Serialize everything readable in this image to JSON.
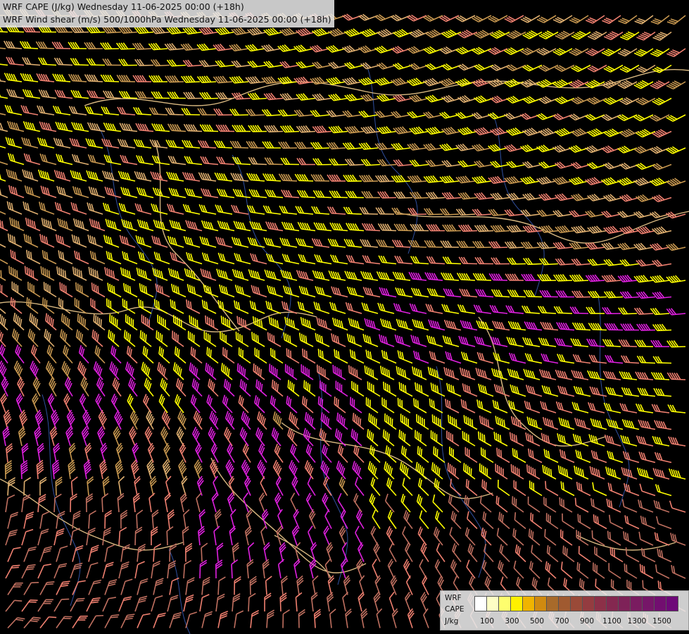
{
  "title": {
    "line1": "WRF CAPE (J/kg) Wednesday 11-06-2025 00:00 (+18h)",
    "line2": "WRF Wind shear (m/s) 500/1000hPa Wednesday 11-06-2025 00:00 (+18h)"
  },
  "legend": {
    "label_line1": "WRF",
    "label_line2": "CAPE",
    "label_line3": "J/kg",
    "colors": [
      "#ffffff",
      "#fefec4",
      "#fefe6e",
      "#fef000",
      "#f0b400",
      "#d08a10",
      "#a86a2a",
      "#a05a30",
      "#9a4a38",
      "#943c40",
      "#8c3048",
      "#842850",
      "#7e2258",
      "#7a1c60",
      "#761668",
      "#720e70",
      "#6e0878"
    ],
    "ticks": [
      "100",
      "300",
      "500",
      "700",
      "900",
      "1100",
      "1300",
      "1500"
    ]
  },
  "map": {
    "field_colors": {
      "black": "#000000",
      "light_brown": "#c89850",
      "tan": "#e0b070",
      "yellow": "#ffff00",
      "salmon": "#f08070",
      "pink_brown": "#c07060",
      "magenta": "#e020e0",
      "border_tan": "#d8b880",
      "river_blue": "#3050a0",
      "white": "#ffffff"
    }
  }
}
